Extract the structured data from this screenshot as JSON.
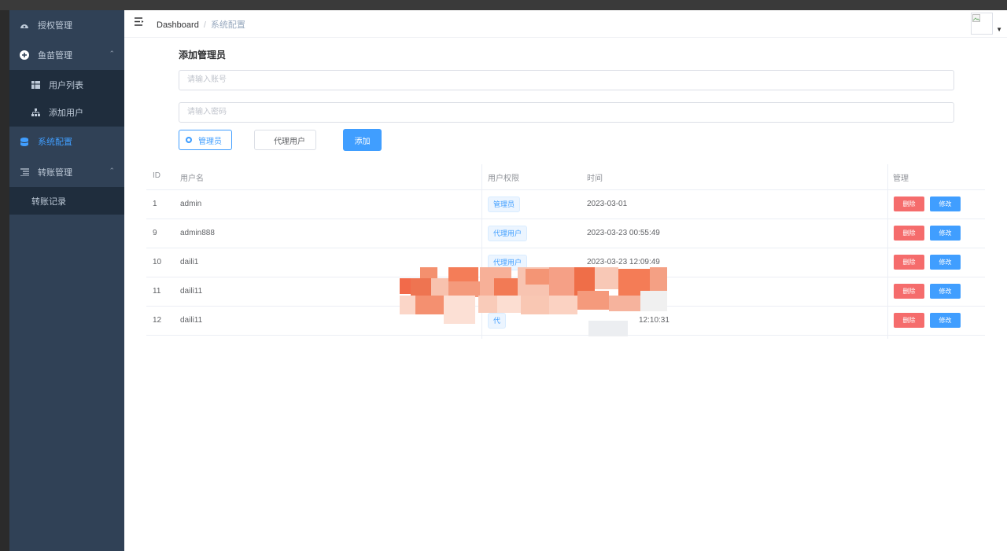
{
  "sidebar": {
    "items": [
      {
        "label": "授权管理",
        "icon": "dashboard-icon"
      },
      {
        "label": "鱼苗管理",
        "icon": "plus-circle-icon"
      },
      {
        "label": "用户列表",
        "icon": "table-icon"
      },
      {
        "label": "添加用户",
        "icon": "tree-icon"
      },
      {
        "label": "系统配置",
        "icon": "database-icon"
      },
      {
        "label": "转账管理",
        "icon": "list-icon"
      },
      {
        "label": "转账记录",
        "icon": ""
      }
    ]
  },
  "header": {
    "breadcrumb_home": "Dashboard",
    "breadcrumb_sep": "/",
    "breadcrumb_current": "系统配置"
  },
  "form": {
    "title": "添加管理员",
    "username_placeholder": "请输入账号",
    "password_placeholder": "请输入密码",
    "radio_admin": "管理员",
    "radio_agent": "代理用户",
    "add_button": "添加"
  },
  "table": {
    "headers": [
      "ID",
      "用户名",
      "用户权限",
      "时间",
      "管理"
    ],
    "rows": [
      {
        "id": "1",
        "username": "admin",
        "role": "管理员",
        "time": "2023-03-01"
      },
      {
        "id": "9",
        "username": "admin888",
        "role": "代理用户",
        "time": "2023-03-23 00:55:49"
      },
      {
        "id": "10",
        "username": "daili1",
        "role": "代理用户",
        "time": "2023-03-23 12:09:49"
      },
      {
        "id": "11",
        "username": "daili11",
        "role": "",
        "time": ""
      },
      {
        "id": "12",
        "username": "daili11",
        "role": "代",
        "time": "12:10:31"
      }
    ],
    "delete_label": "删除",
    "edit_label": "修改"
  },
  "colors": {
    "primary": "#409eff",
    "danger": "#f56c6c",
    "sidebar": "#304156",
    "submenu": "#1f2d3d"
  }
}
